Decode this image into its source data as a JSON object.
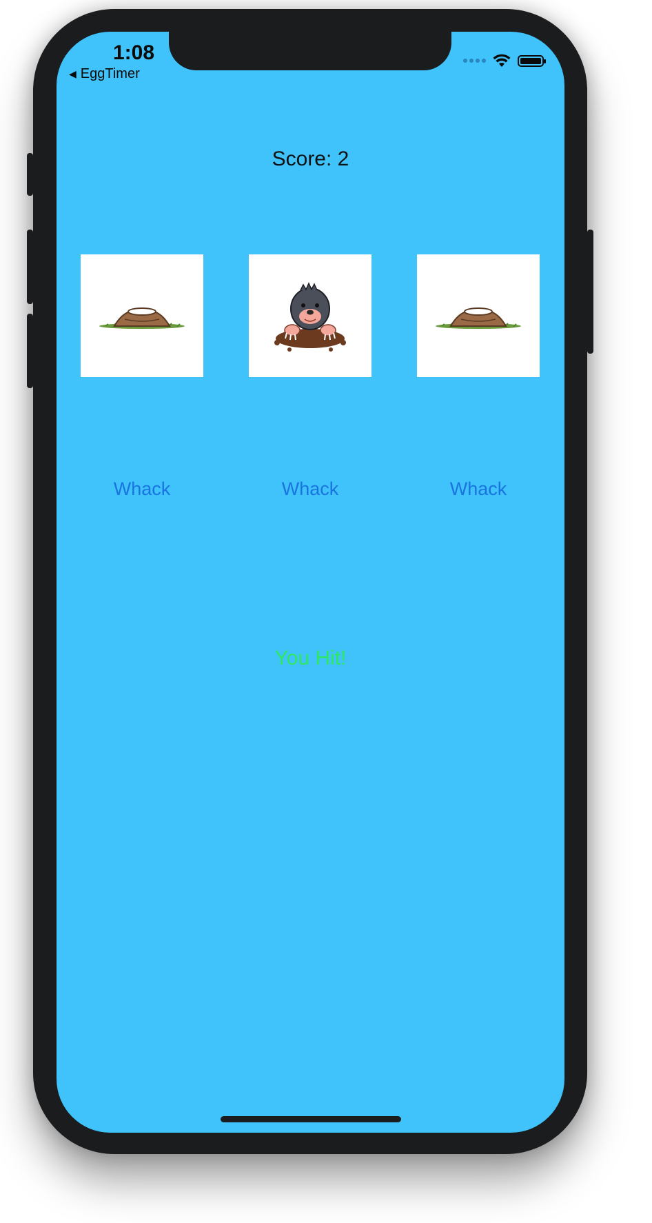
{
  "status_bar": {
    "time": "1:08",
    "back_app": "EggTimer"
  },
  "game": {
    "score_label": "Score:  2",
    "tiles": [
      {
        "state": "empty hole"
      },
      {
        "state": "mole"
      },
      {
        "state": "empty hole"
      }
    ],
    "buttons": [
      "Whack",
      "Whack",
      "Whack"
    ],
    "result": "You Hit!"
  },
  "colors": {
    "screen_background": "#3fc3fa",
    "button_text": "#1a74e0",
    "result_text": "#2ee860"
  }
}
